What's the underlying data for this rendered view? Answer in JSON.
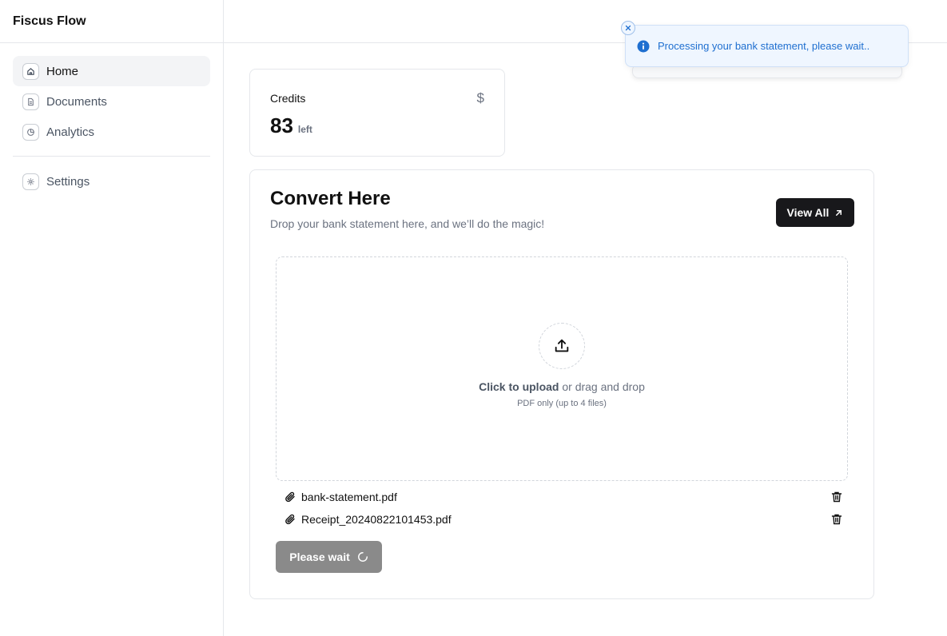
{
  "app": {
    "brand": "Fiscus Flow"
  },
  "sidebar": {
    "items": [
      {
        "label": "Home",
        "icon": "home-icon",
        "active": true
      },
      {
        "label": "Documents",
        "icon": "document-icon",
        "active": false
      },
      {
        "label": "Analytics",
        "icon": "pie-chart-icon",
        "active": false
      },
      {
        "label": "Settings",
        "icon": "gear-icon",
        "active": false
      }
    ]
  },
  "credits": {
    "title": "Credits",
    "value": "83",
    "unit": "left",
    "icon": "dollar-icon"
  },
  "convert": {
    "title": "Convert Here",
    "subtitle": "Drop your bank statement here, and we’ll do the magic!",
    "view_all_label": "View All",
    "upload_strong": "Click to upload",
    "upload_rest": " or drag and drop",
    "upload_hint": "PDF only (up to 4 files)",
    "files": [
      {
        "name": "bank-statement.pdf"
      },
      {
        "name": "Receipt_20240822101453.pdf"
      }
    ],
    "submit_label": "Please wait"
  },
  "toast": {
    "message": "Processing your bank statement, please wait..",
    "type": "info"
  },
  "colors": {
    "accent_dark": "#18181b",
    "toast_text": "#1f6fd0",
    "toast_bg": "#eff6ff",
    "disabled_button": "#8a8a8a"
  }
}
